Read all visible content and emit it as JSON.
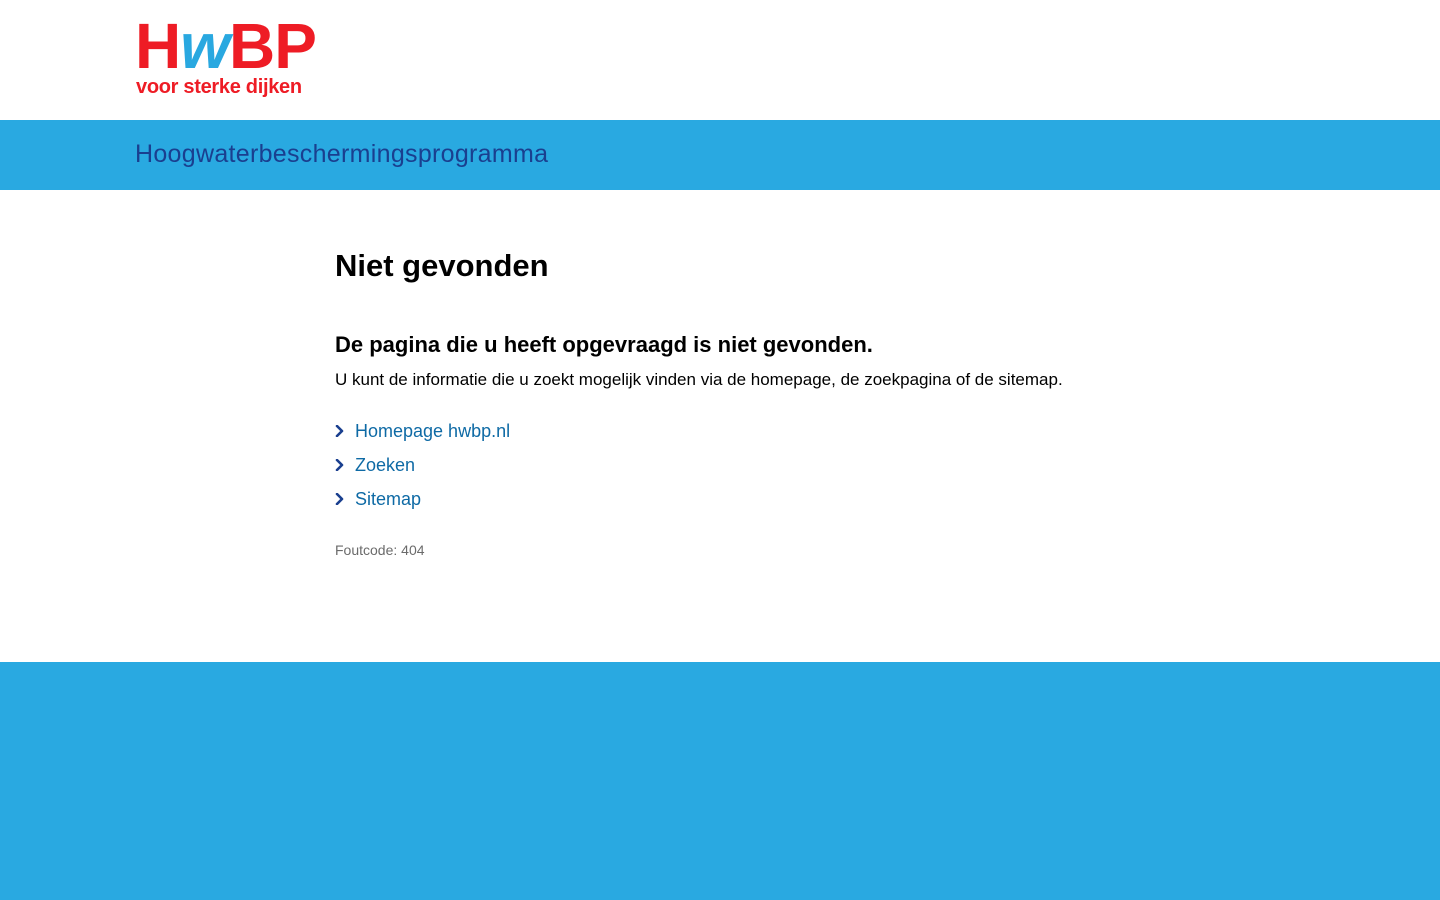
{
  "logo": {
    "letter_h": "H",
    "letter_w": "w",
    "letters_bp": "BP",
    "tagline": "voor sterke dijken"
  },
  "program_bar": {
    "title": "Hoogwaterbeschermingsprogramma"
  },
  "main": {
    "title": "Niet gevonden",
    "subheading": "De pagina die u heeft opgevraagd is niet gevonden.",
    "intro": "U kunt de informatie die u zoekt mogelijk vinden via de homepage, de zoekpagina of de sitemap.",
    "links": [
      {
        "label": "Homepage hwbp.nl",
        "icon": "chevron-right-icon"
      },
      {
        "label": "Zoeken",
        "icon": "chevron-right-icon"
      },
      {
        "label": "Sitemap",
        "icon": "chevron-right-icon"
      }
    ],
    "error_code": "Foutcode: 404"
  },
  "colors": {
    "brand_red": "#ee1c25",
    "brand_blue": "#29a9e1",
    "title_navy": "#1a3f8f",
    "link_blue": "#0e6aa5"
  }
}
